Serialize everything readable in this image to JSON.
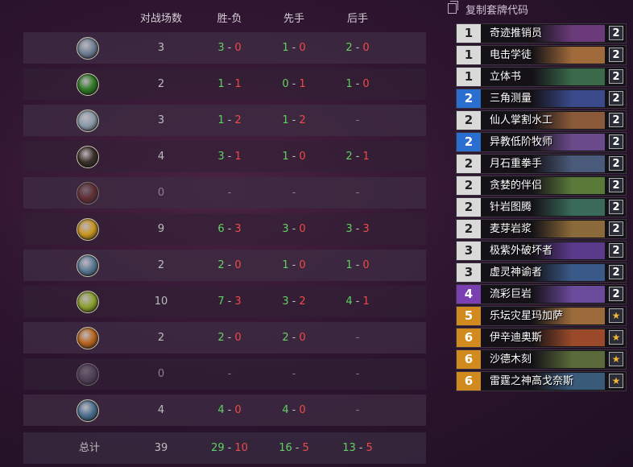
{
  "headers": {
    "games": "对战场数",
    "win_loss": "胜-负",
    "first": "先手",
    "second": "后手"
  },
  "rows": [
    {
      "icon": "mage-class-icon",
      "games": "3",
      "wl_w": "3",
      "wl_l": "0",
      "f_w": "1",
      "f_l": "0",
      "s_w": "2",
      "s_l": "0",
      "icon_color": "#6f7f94"
    },
    {
      "icon": "demon-hunter-class-icon",
      "games": "2",
      "wl_w": "1",
      "wl_l": "1",
      "f_w": "0",
      "f_l": "1",
      "s_w": "1",
      "s_l": "0",
      "icon_color": "#2f7a24"
    },
    {
      "icon": "hunter-class-icon",
      "games": "3",
      "wl_w": "1",
      "wl_l": "2",
      "f_w": "1",
      "f_l": "2",
      "s_w": "",
      "s_l": "",
      "icon_color": "#8a9aa8"
    },
    {
      "icon": "rogue-class-icon",
      "games": "4",
      "wl_w": "3",
      "wl_l": "1",
      "f_w": "1",
      "f_l": "0",
      "s_w": "2",
      "s_l": "1",
      "icon_color": "#3a3028"
    },
    {
      "icon": "warrior-class-icon",
      "games": "0",
      "wl_w": "",
      "wl_l": "",
      "f_w": "",
      "f_l": "",
      "s_w": "",
      "s_l": "",
      "icon_color": "#8a3a22"
    },
    {
      "icon": "paladin-class-icon",
      "games": "9",
      "wl_w": "6",
      "wl_l": "3",
      "f_w": "3",
      "f_l": "0",
      "s_w": "3",
      "s_l": "3",
      "icon_color": "#c8951f"
    },
    {
      "icon": "shaman-class-icon",
      "games": "2",
      "wl_w": "2",
      "wl_l": "0",
      "f_w": "1",
      "f_l": "0",
      "s_w": "1",
      "s_l": "0",
      "icon_color": "#5a7a94"
    },
    {
      "icon": "druid-class-icon",
      "games": "10",
      "wl_w": "7",
      "wl_l": "3",
      "f_w": "3",
      "f_l": "2",
      "s_w": "4",
      "s_l": "1",
      "icon_color": "#8aa02c"
    },
    {
      "icon": "warlock-class-icon",
      "games": "2",
      "wl_w": "2",
      "wl_l": "0",
      "f_w": "2",
      "f_l": "0",
      "s_w": "",
      "s_l": "",
      "icon_color": "#b8651e"
    },
    {
      "icon": "priest-class-icon",
      "games": "0",
      "wl_w": "",
      "wl_l": "",
      "f_w": "",
      "f_l": "",
      "s_w": "",
      "s_l": "",
      "icon_color": "#7a6f86"
    },
    {
      "icon": "death-knight-class-icon",
      "games": "4",
      "wl_w": "4",
      "wl_l": "0",
      "f_w": "4",
      "f_l": "0",
      "s_w": "",
      "s_l": "",
      "icon_color": "#4a6f8f"
    }
  ],
  "total": {
    "label": "总计",
    "games": "39",
    "wl_w": "29",
    "wl_l": "10",
    "f_w": "16",
    "f_l": "5",
    "s_w": "13",
    "s_l": "5"
  },
  "dash": "-",
  "copy_label": "复制套牌代码",
  "cards": [
    {
      "cost": "1",
      "name": "奇迹推销员",
      "count": "2",
      "rarity": "common",
      "art": "#6a3a7a"
    },
    {
      "cost": "1",
      "name": "电击学徒",
      "count": "2",
      "rarity": "common",
      "art": "#a06a3a"
    },
    {
      "cost": "1",
      "name": "立体书",
      "count": "2",
      "rarity": "common",
      "art": "#3a6a4a"
    },
    {
      "cost": "2",
      "name": "三角测量",
      "count": "2",
      "rarity": "rare",
      "art": "#3a4a8a"
    },
    {
      "cost": "2",
      "name": "仙人掌割水工",
      "count": "2",
      "rarity": "common",
      "art": "#8a5a3a"
    },
    {
      "cost": "2",
      "name": "异教低阶牧师",
      "count": "2",
      "rarity": "rare",
      "art": "#6a4a8a"
    },
    {
      "cost": "2",
      "name": "月石重拳手",
      "count": "2",
      "rarity": "common",
      "art": "#4a5a7a"
    },
    {
      "cost": "2",
      "name": "贪婪的伴侣",
      "count": "2",
      "rarity": "common",
      "art": "#5a7a3a"
    },
    {
      "cost": "2",
      "name": "针岩图腾",
      "count": "2",
      "rarity": "common",
      "art": "#3a6a5a"
    },
    {
      "cost": "2",
      "name": "麦芽岩浆",
      "count": "2",
      "rarity": "common",
      "art": "#8a6a3a"
    },
    {
      "cost": "3",
      "name": "极紫外破坏者",
      "count": "2",
      "rarity": "common",
      "art": "#5a3a8a"
    },
    {
      "cost": "3",
      "name": "虚灵神谕者",
      "count": "2",
      "rarity": "common",
      "art": "#3a5a8a"
    },
    {
      "cost": "4",
      "name": "流彩巨岩",
      "count": "2",
      "rarity": "epic",
      "art": "#6a4a9a"
    },
    {
      "cost": "5",
      "name": "乐坛灾星玛加萨",
      "count": "★",
      "rarity": "legendary",
      "art": "#9a6a3a"
    },
    {
      "cost": "6",
      "name": "伊辛迪奥斯",
      "count": "★",
      "rarity": "legendary",
      "art": "#9a4a2a"
    },
    {
      "cost": "6",
      "name": "沙德木刻",
      "count": "★",
      "rarity": "legendary",
      "art": "#5a6a3a"
    },
    {
      "cost": "6",
      "name": "雷霆之神高戈奈斯",
      "count": "★",
      "rarity": "legendary",
      "art": "#3a5a7a"
    }
  ],
  "colors": {
    "win": "#5fd35f",
    "loss": "#ef4a4a",
    "common": "#d9d9d9",
    "rare": "#2a6fd0",
    "epic": "#7a3fb0",
    "legendary": "#d08a1e"
  }
}
